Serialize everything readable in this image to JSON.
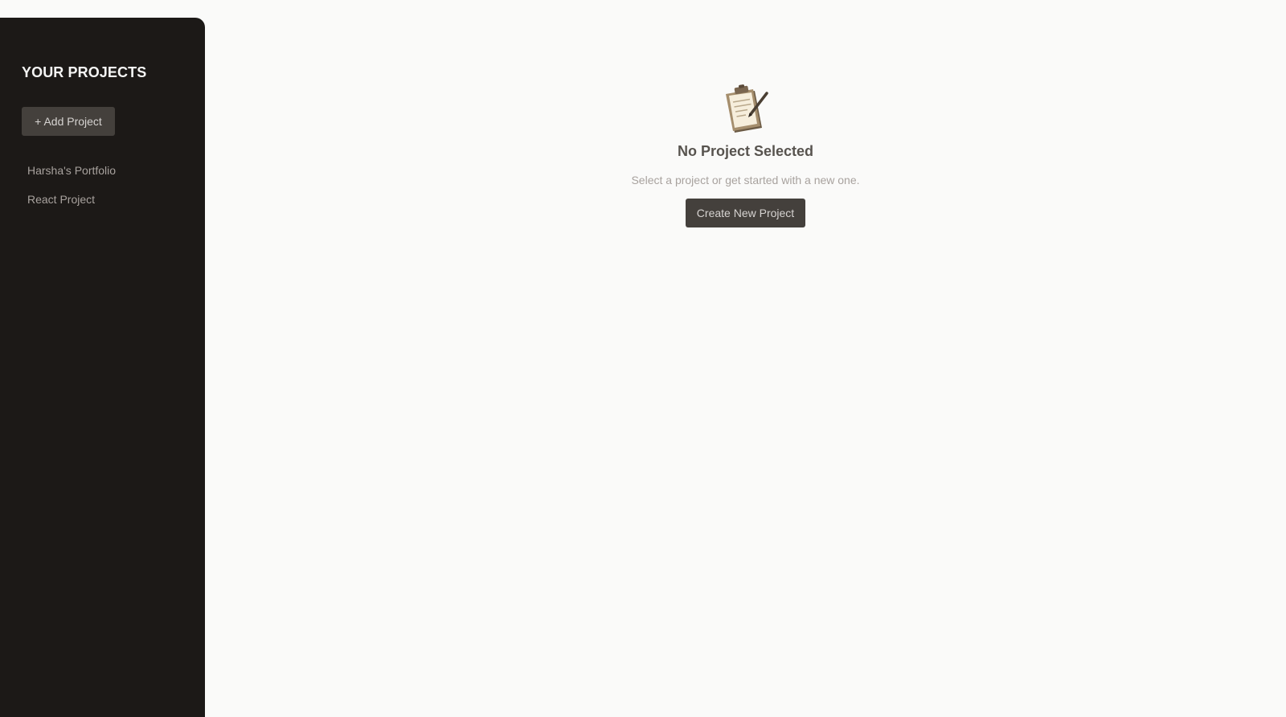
{
  "sidebar": {
    "title": "YOUR PROJECTS",
    "add_button": {
      "icon": "plus-icon",
      "label": "+ Add Project"
    },
    "projects": [
      {
        "label": "Harsha's Portfolio"
      },
      {
        "label": "React Project"
      }
    ]
  },
  "main": {
    "empty_state": {
      "icon": "clipboard-icon",
      "title": "No Project Selected",
      "subtitle": "Select a project or get started with a new one.",
      "create_button_label": "Create New Project"
    }
  },
  "colors": {
    "sidebar_bg": "#1c1917",
    "main_bg": "#fafaf9",
    "button_bg": "#44403c",
    "button_text": "#d6d3d1",
    "heading_text": "#57534e",
    "muted_text": "#a8a29e"
  }
}
